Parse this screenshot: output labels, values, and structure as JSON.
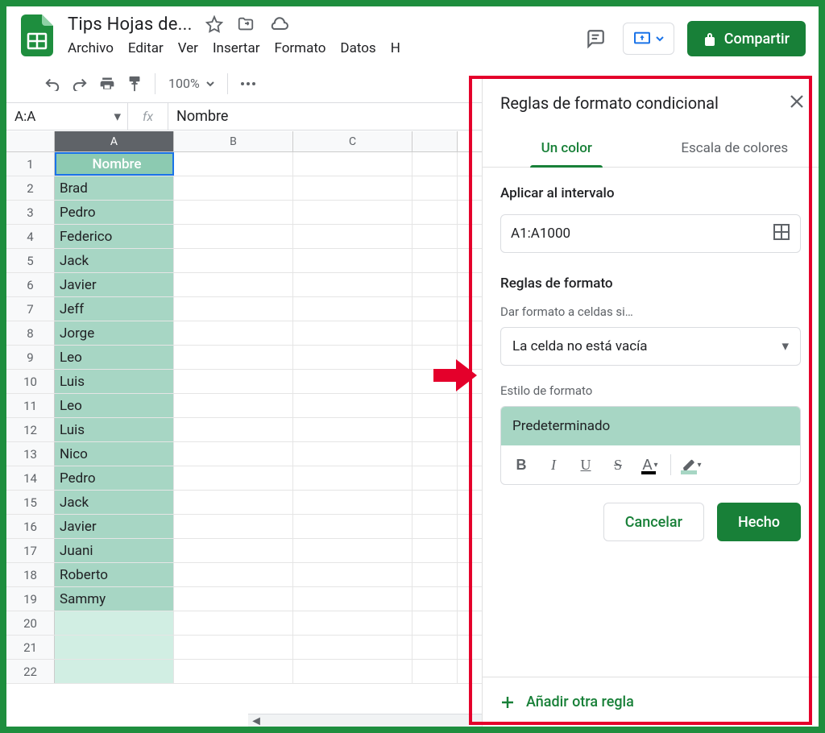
{
  "doc_title": "Tips Hojas de...",
  "menubar": [
    "Archivo",
    "Editar",
    "Ver",
    "Insertar",
    "Formato",
    "Datos",
    "H"
  ],
  "share_label": "Compartir",
  "zoom": "100%",
  "namebox": "A:A",
  "formula": "Nombre",
  "columns": [
    "A",
    "B",
    "C"
  ],
  "rows": [
    {
      "n": "1",
      "a": "Nombre",
      "header": true
    },
    {
      "n": "2",
      "a": "Brad"
    },
    {
      "n": "3",
      "a": "Pedro"
    },
    {
      "n": "4",
      "a": "Federico"
    },
    {
      "n": "5",
      "a": "Jack"
    },
    {
      "n": "6",
      "a": "Javier"
    },
    {
      "n": "7",
      "a": "Jeff"
    },
    {
      "n": "8",
      "a": "Jorge"
    },
    {
      "n": "9",
      "a": "Leo"
    },
    {
      "n": "10",
      "a": "Luis"
    },
    {
      "n": "11",
      "a": "Leo"
    },
    {
      "n": "12",
      "a": "Luis"
    },
    {
      "n": "13",
      "a": "Nico"
    },
    {
      "n": "14",
      "a": "Pedro"
    },
    {
      "n": "15",
      "a": "Jack"
    },
    {
      "n": "16",
      "a": "Javier"
    },
    {
      "n": "17",
      "a": "Juani"
    },
    {
      "n": "18",
      "a": "Roberto"
    },
    {
      "n": "19",
      "a": "Sammy"
    },
    {
      "n": "20",
      "a": "",
      "empty": true
    },
    {
      "n": "21",
      "a": "",
      "empty": true
    },
    {
      "n": "22",
      "a": "",
      "empty": true
    }
  ],
  "panel": {
    "title": "Reglas de formato condicional",
    "tab_single": "Un color",
    "tab_scale": "Escala de colores",
    "apply_to_label": "Aplicar al intervalo",
    "range": "A1:A1000",
    "rules_label": "Reglas de formato",
    "format_if_hint": "Dar formato a celdas si…",
    "condition": "La celda no está vacía",
    "style_label": "Estilo de formato",
    "style_name": "Predeterminado",
    "cancel": "Cancelar",
    "done": "Hecho",
    "add_rule": "Añadir otra regla"
  }
}
